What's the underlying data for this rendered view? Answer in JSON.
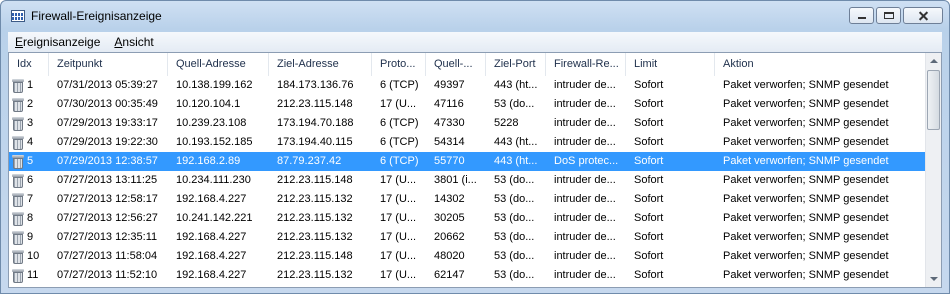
{
  "window": {
    "title": "Firewall-Ereignisanzeige"
  },
  "menu": [
    {
      "mnemonic": "E",
      "rest": "reignisanzeige"
    },
    {
      "mnemonic": "A",
      "rest": "nsicht"
    }
  ],
  "columns": [
    "Idx",
    "Zeitpunkt",
    "Quell-Adresse",
    "Ziel-Adresse",
    "Proto...",
    "Quell-...",
    "Ziel-Port",
    "Firewall-Re...",
    "Limit",
    "Aktion"
  ],
  "rows": [
    [
      "1",
      "07/31/2013 05:39:27",
      "10.138.199.162",
      "184.173.136.76",
      "6 (TCP)",
      "49397",
      "443 (ht...",
      "intruder de...",
      "Sofort",
      "Paket verworfen; SNMP gesendet"
    ],
    [
      "2",
      "07/30/2013 00:35:49",
      "10.120.104.1",
      "212.23.115.148",
      "17 (U...",
      "47116",
      "53 (do...",
      "intruder de...",
      "Sofort",
      "Paket verworfen; SNMP gesendet"
    ],
    [
      "3",
      "07/29/2013 19:33:17",
      "10.239.23.108",
      "173.194.70.188",
      "6 (TCP)",
      "47330",
      "5228",
      "intruder de...",
      "Sofort",
      "Paket verworfen; SNMP gesendet"
    ],
    [
      "4",
      "07/29/2013 19:22:30",
      "10.193.152.185",
      "173.194.40.115",
      "6 (TCP)",
      "54314",
      "443 (ht...",
      "intruder de...",
      "Sofort",
      "Paket verworfen; SNMP gesendet"
    ],
    [
      "5",
      "07/29/2013 12:38:57",
      "192.168.2.89",
      "87.79.237.42",
      "6 (TCP)",
      "55770",
      "443 (ht...",
      "DoS protec...",
      "Sofort",
      "Paket verworfen; SNMP gesendet"
    ],
    [
      "6",
      "07/27/2013 13:11:25",
      "10.234.111.230",
      "212.23.115.148",
      "17 (U...",
      "3801 (i...",
      "53 (do...",
      "intruder de...",
      "Sofort",
      "Paket verworfen; SNMP gesendet"
    ],
    [
      "7",
      "07/27/2013 12:58:17",
      "192.168.4.227",
      "212.23.115.132",
      "17 (U...",
      "14302",
      "53 (do...",
      "intruder de...",
      "Sofort",
      "Paket verworfen; SNMP gesendet"
    ],
    [
      "8",
      "07/27/2013 12:56:27",
      "10.241.142.221",
      "212.23.115.132",
      "17 (U...",
      "30205",
      "53 (do...",
      "intruder de...",
      "Sofort",
      "Paket verworfen; SNMP gesendet"
    ],
    [
      "9",
      "07/27/2013 12:35:11",
      "192.168.4.227",
      "212.23.115.132",
      "17 (U...",
      "20662",
      "53 (do...",
      "intruder de...",
      "Sofort",
      "Paket verworfen; SNMP gesendet"
    ],
    [
      "10",
      "07/27/2013 11:58:04",
      "192.168.4.227",
      "212.23.115.148",
      "17 (U...",
      "48020",
      "53 (do...",
      "intruder de...",
      "Sofort",
      "Paket verworfen; SNMP gesendet"
    ],
    [
      "11",
      "07/27/2013 11:52:10",
      "192.168.4.227",
      "212.23.115.132",
      "17 (U...",
      "62147",
      "53 (do...",
      "intruder de...",
      "Sofort",
      "Paket verworfen; SNMP gesendet"
    ]
  ],
  "selected_row": 4,
  "row_icon": "trash-icon",
  "colors": {
    "selection": "#3399ff",
    "title_bar": "#b9d1ea"
  }
}
